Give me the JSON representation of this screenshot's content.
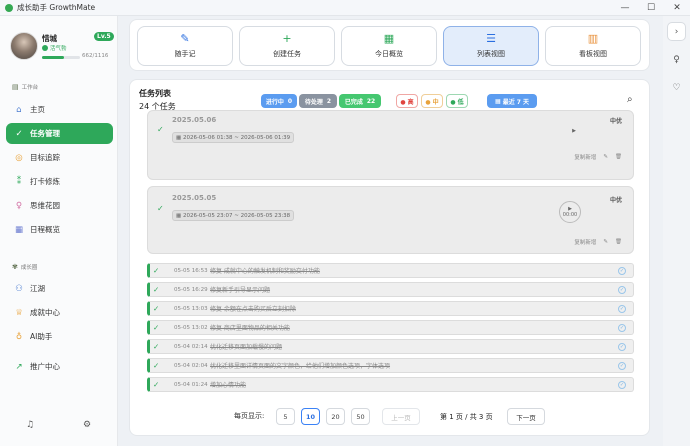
{
  "window": {
    "title": "成长助手 GrowthMate",
    "controls": [
      "—",
      "☐",
      "✕"
    ]
  },
  "user": {
    "name": "惜城",
    "level": "Lv.5",
    "status": "活气勃",
    "xp_text": "662/1116",
    "xp_fraction": 0.59
  },
  "sidebar": {
    "section1": "工作台",
    "items1": [
      {
        "label": "主页",
        "icon": "⌂",
        "icon_name": "home-icon"
      },
      {
        "label": "任务管理",
        "icon": "✓",
        "icon_name": "task-check-icon",
        "active": true
      },
      {
        "label": "目标追踪",
        "icon": "◎",
        "icon_name": "target-icon"
      },
      {
        "label": "打卡修炼",
        "icon": "⁑",
        "icon_name": "checkin-icon"
      },
      {
        "label": "思维花园",
        "icon": "♀",
        "icon_name": "bulb-icon"
      },
      {
        "label": "日程概览",
        "icon": "▦",
        "icon_name": "calendar-icon"
      }
    ],
    "section2": "成长圈",
    "items2": [
      {
        "label": "江湖",
        "icon": "⚇",
        "icon_name": "people-icon"
      },
      {
        "label": "成就中心",
        "icon": "♕",
        "icon_name": "trophy-icon"
      },
      {
        "label": "AI助手",
        "icon": "♁",
        "icon_name": "ai-icon"
      }
    ],
    "promo": {
      "label": "推广中心",
      "icon": "↗",
      "icon_name": "trend-icon"
    },
    "bottom": [
      {
        "icon": "♫",
        "name": "bell-icon"
      },
      {
        "icon": "⚙",
        "name": "settings-icon"
      }
    ]
  },
  "tabs": [
    {
      "label": "随手记",
      "icon": "✎",
      "icon_name": "pen-icon",
      "color": "#2b6fe0"
    },
    {
      "label": "创建任务",
      "icon": "+",
      "icon_name": "plus-icon",
      "color": "#2ea85a"
    },
    {
      "label": "今日概览",
      "icon": "▦",
      "icon_name": "grid-icon",
      "color": "#2ea85a"
    },
    {
      "label": "列表视图",
      "icon": "☰",
      "icon_name": "list-icon",
      "color": "#2b6fe0",
      "active": true
    },
    {
      "label": "看板视图",
      "icon": "▥",
      "icon_name": "kanban-icon",
      "color": "#e8903a"
    }
  ],
  "right_strip": [
    {
      "icon": "›",
      "name": "collapse-icon"
    },
    {
      "icon": "♀",
      "name": "lightbulb-icon"
    },
    {
      "icon": "♡",
      "name": "heart-icon"
    }
  ],
  "main": {
    "title": "任务列表",
    "count": "24 个任务",
    "filters": [
      {
        "label": "进行中",
        "num": "0",
        "bg": "#5b9cf0",
        "fg": "#fff"
      },
      {
        "label": "待处理",
        "num": "2",
        "bg": "#8a93a0",
        "fg": "#fff"
      },
      {
        "label": "已完成",
        "num": "22",
        "bg": "#45c770",
        "fg": "#fff"
      }
    ],
    "priority_filters": [
      {
        "label": "● 高",
        "color": "#e0443f",
        "border": "#f0a7a4"
      },
      {
        "label": "● 中",
        "color": "#e8a23a",
        "border": "#f0cf99"
      },
      {
        "label": "● 低",
        "color": "#2ea85a",
        "border": "#9ed8b2"
      }
    ],
    "range_filter": "最近 7 天",
    "cards": [
      {
        "date": "2025.05.06",
        "range": "2026-05-06 01:38 ~ 2026-05-06 01:39",
        "priority": "中优",
        "timer": "▶",
        "actions": [
          "复制新增",
          "✎",
          "🗑"
        ]
      },
      {
        "date": "2025.05.05",
        "range": "2026-05-05 23:07 ~ 2026-05-05 23:38",
        "priority": "中优",
        "timer": "▶",
        "timer_text": "00:00",
        "actions": [
          "复制新增",
          "✎",
          "🗑"
        ]
      }
    ],
    "rows": [
      {
        "time": "05-05 16:53",
        "text": "修复 成就中心的触发机制和奖励交付功能"
      },
      {
        "time": "05-05 16:29",
        "text": "修复新手引导显示问题"
      },
      {
        "time": "05-05 13:03",
        "text": "修复 余额在点击购买后立刻扣除"
      },
      {
        "time": "05-05 13:02",
        "text": "修复 商店里面物品的相关功能"
      },
      {
        "time": "05-04 02:14",
        "text": "优化迁移页面加载慢的问题"
      },
      {
        "time": "05-04 02:04",
        "text": "优化迁移里面详情页面的文字颜色，给他们增加颜色选项，字体选项"
      },
      {
        "time": "05-04 01:24",
        "text": "增加心情功能"
      }
    ],
    "pager": {
      "label": "每页显示:",
      "sizes": [
        "5",
        "10",
        "20",
        "50"
      ],
      "active": "10",
      "prev": "上一页",
      "info": "第 1 页 / 共 3 页",
      "next": "下一页"
    }
  }
}
